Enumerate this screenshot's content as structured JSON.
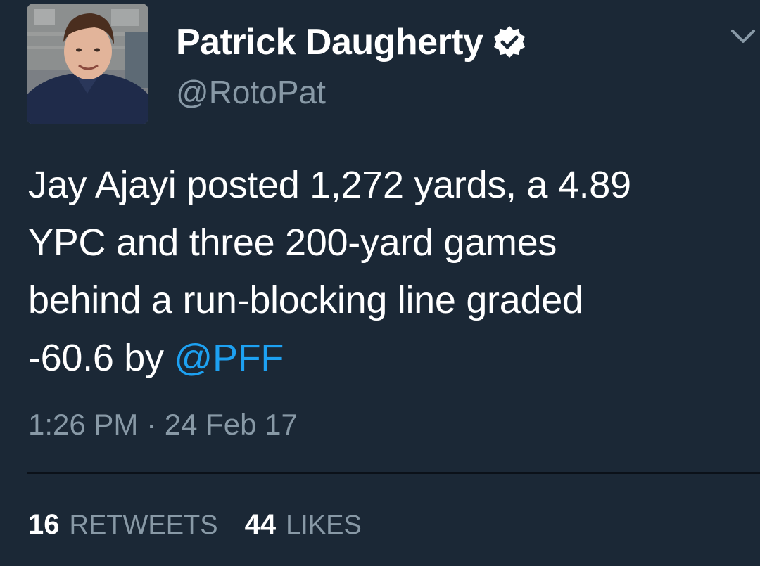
{
  "author": {
    "display_name": "Patrick Daugherty",
    "handle": "@RotoPat",
    "verified": true
  },
  "tweet": {
    "lines": [
      [
        "Jay Ajayi posted 1,272 yards, a 4.89"
      ],
      [
        "YPC and three 200-yard games"
      ],
      [
        "behind a run-blocking line graded"
      ],
      [
        "-60.6 by ",
        "@PFF"
      ]
    ],
    "line1": "Jay Ajayi posted 1,272 yards, a 4.89",
    "line2": "YPC and three 200-yard games",
    "line3": "behind a run-blocking line graded",
    "line4_text": "-60.6 by ",
    "mention": "@PFF",
    "timestamp": "1:26 PM · 24 Feb 17"
  },
  "stats": {
    "retweets_count": "16",
    "retweets_label": "RETWEETS",
    "likes_count": "44",
    "likes_label": "LIKES"
  },
  "colors": {
    "background": "#1b2836",
    "text": "#ffffff",
    "secondary": "#8899a6",
    "link": "#1da1f2",
    "divider": "#0b1119"
  },
  "icons": {
    "verified": "verified-badge-icon",
    "menu": "chevron-down-icon"
  }
}
